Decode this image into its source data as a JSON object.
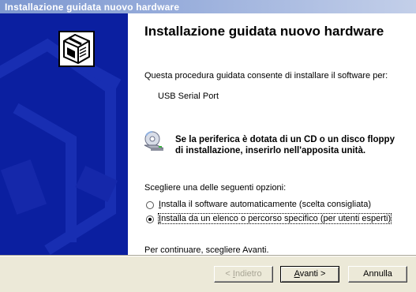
{
  "window": {
    "title": "Installazione guidata nuovo hardware"
  },
  "page": {
    "heading": "Installazione guidata nuovo hardware",
    "intro": "Questa procedura guidata consente di installare il software per:",
    "device": "USB Serial Port",
    "cd_line1": "Se la periferica è dotata di un CD o un disco floppy",
    "cd_line2": "di installazione, inserirlo nell'apposita unità.",
    "options_label": "Scegliere una delle seguenti opzioni:",
    "options": [
      {
        "accel": "I",
        "rest": "nstalla il software automaticamente (scelta consigliata)",
        "selected": false
      },
      {
        "accel": "I",
        "rest": "nstalla da un elenco o percorso specifico (per utenti esperti)",
        "selected": true
      }
    ],
    "continue_text": "Per continuare, scegliere Avanti."
  },
  "buttons": {
    "back_prefix": "< ",
    "back_accel": "I",
    "back_rest": "ndietro",
    "next_accel": "A",
    "next_rest": "vanti >",
    "cancel": "Annulla"
  },
  "icons": {
    "sidebar": "hardware-box-icon",
    "cd": "cd-drive-icon"
  },
  "colors": {
    "sidebar": "#0b1fa0",
    "titlebar": "#7d98d0"
  }
}
